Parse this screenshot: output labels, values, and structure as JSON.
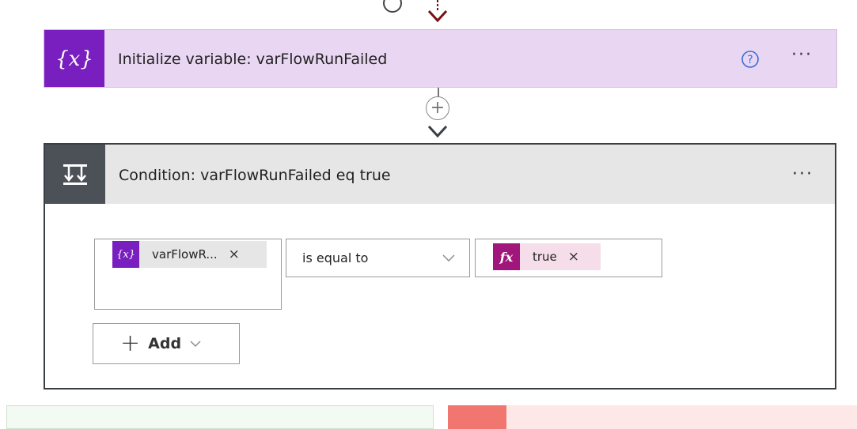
{
  "initialize_step": {
    "title": "Initialize variable: varFlowRunFailed",
    "icon": "variable-icon",
    "help_icon": "help-icon",
    "more_label": "···"
  },
  "condition_step": {
    "title": "Condition: varFlowRunFailed eq true",
    "icon": "condition-icon",
    "more_label": "···",
    "left_operand": {
      "icon_text": "{x}",
      "label": "varFlowR...",
      "remove_label": "×"
    },
    "operator": {
      "selected": "is equal to"
    },
    "right_operand": {
      "icon_text": "fx",
      "label": "true",
      "remove_label": "×"
    },
    "add_button": {
      "plus": "+",
      "label": "Add"
    }
  },
  "connector": {
    "insert_label": "+"
  },
  "colors": {
    "variable_accent": "#7a1fbf",
    "variable_card_bg": "#e9d6f2",
    "condition_header": "#4b5157",
    "expression_accent": "#a0167a",
    "arrow": "#7a1010",
    "no_branch": "#f0766f",
    "yes_branch_bg": "#f3faf3"
  }
}
